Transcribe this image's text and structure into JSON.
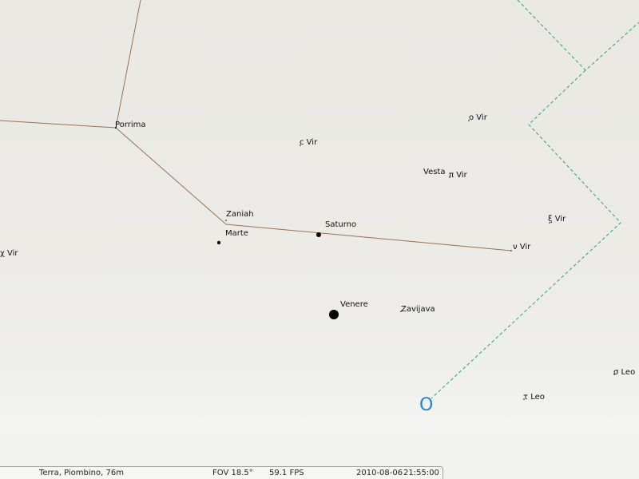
{
  "objects": {
    "porrima": "Porrima",
    "c_vir": "c Vir",
    "o_vir": "o Vir",
    "vesta": "Vesta",
    "pi_vir": "π Vir",
    "zaniah": "Zaniah",
    "marte": "Marte",
    "saturno": "Saturno",
    "xi_vir": "ξ Vir",
    "chi_vir": "χ Vir",
    "nu_vir": "ν Vir",
    "venere": "Venere",
    "zavijava": "Zavijava",
    "sigma_leo": "σ Leo",
    "tau_leo": "τ Leo"
  },
  "compass": {
    "label": "O",
    "color": "#1e86c9"
  },
  "colors": {
    "constellation_line": "#9b7150",
    "boundary": "#2aa07a"
  },
  "status_bar": {
    "location": "Terra, Piombino, 76m",
    "fov": "FOV 18.5°",
    "fps": "59.1 FPS",
    "date": "2010-08-06",
    "time": "21:55:00"
  }
}
